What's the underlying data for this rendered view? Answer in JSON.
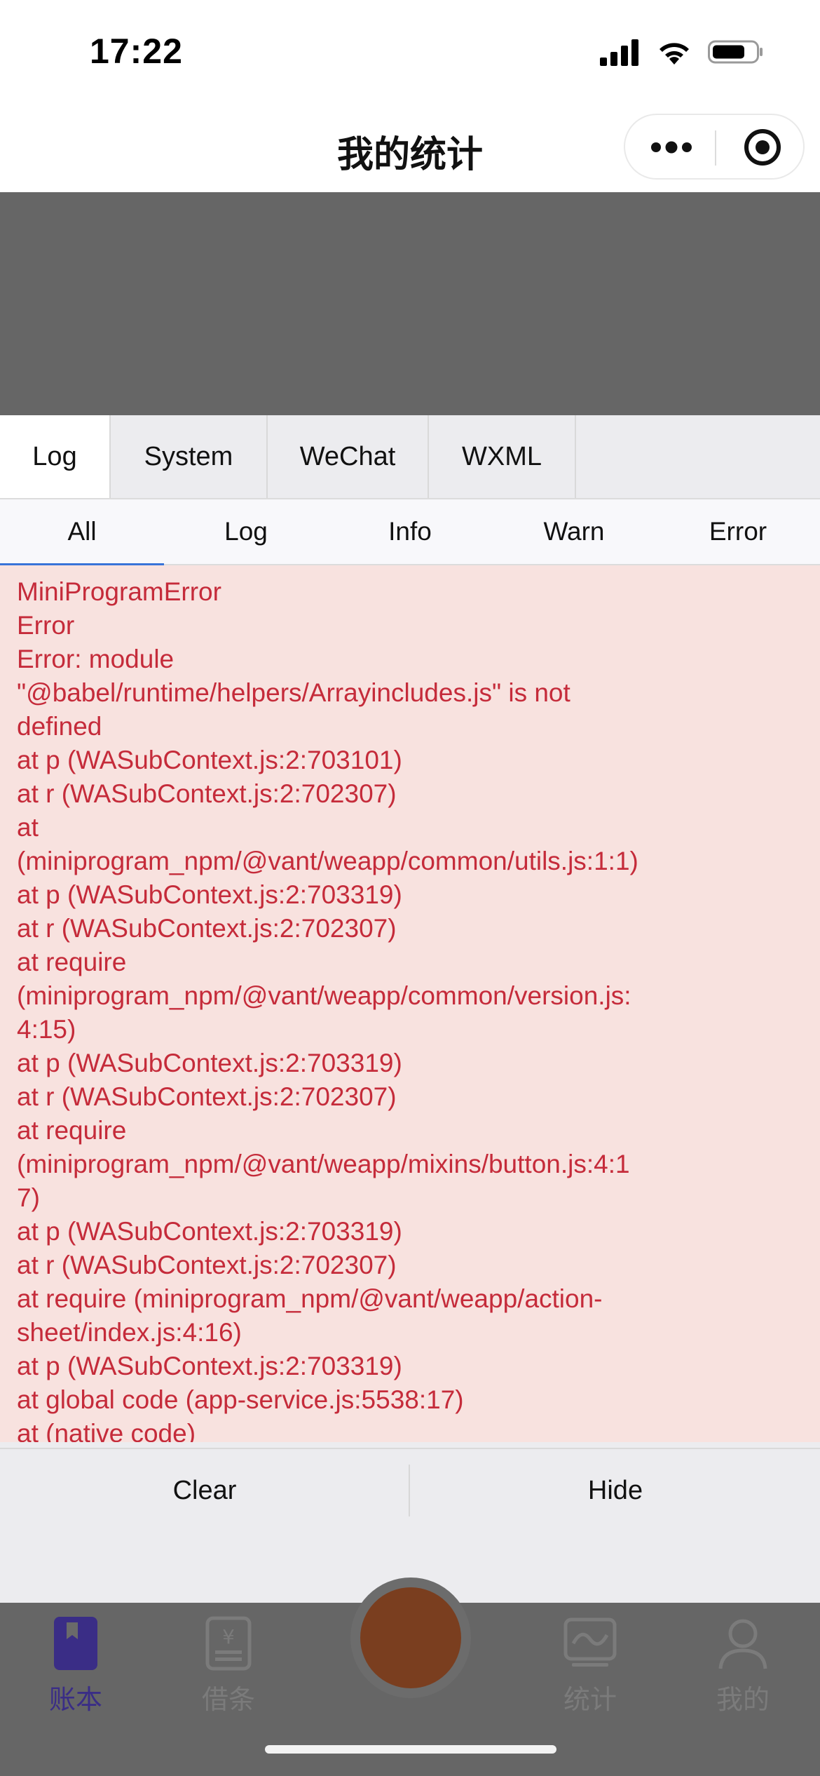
{
  "status_bar": {
    "time": "17:22",
    "icons": [
      "signal-icon",
      "wifi-icon",
      "battery-icon"
    ]
  },
  "nav": {
    "title": "我的统计",
    "capsule": [
      "more-icon",
      "target-icon"
    ]
  },
  "console": {
    "tabs": [
      "Log",
      "System",
      "WeChat",
      "WXML"
    ],
    "active_tab": "Log",
    "subtabs": [
      "All",
      "Log",
      "Info",
      "Warn",
      "Error"
    ],
    "active_subtab": "All",
    "log_lines": [
      "MiniProgramError",
      "Error",
      "Error: module",
      "\"@babel/runtime/helpers/Arrayincludes.js\" is not",
      "defined",
      "at p (WASubContext.js:2:703101)",
      "at r (WASubContext.js:2:702307)",
      "at",
      "(miniprogram_npm/@vant/weapp/common/utils.js:1:1)",
      "at p (WASubContext.js:2:703319)",
      "at r (WASubContext.js:2:702307)",
      "at require",
      "(miniprogram_npm/@vant/weapp/common/version.js:",
      "4:15)",
      "at p (WASubContext.js:2:703319)",
      "at r (WASubContext.js:2:702307)",
      "at require",
      "(miniprogram_npm/@vant/weapp/mixins/button.js:4:1",
      "7)",
      "at p (WASubContext.js:2:703319)",
      "at r (WASubContext.js:2:702307)",
      "at require (miniprogram_npm/@vant/weapp/action-",
      "sheet/index.js:4:16)",
      "at p (WASubContext.js:2:703319)",
      "at global code (app-service.js:5538:17)",
      "at (native code)"
    ],
    "buttons": {
      "clear": "Clear",
      "hide": "Hide"
    },
    "colors": {
      "error_text": "#c52b3a",
      "error_bg": "#f8e2df",
      "active_underline": "#3874d8"
    }
  },
  "tabbar": {
    "items": [
      {
        "label": "账本",
        "icon": "ledger-icon",
        "active": true
      },
      {
        "label": "借条",
        "icon": "iou-icon",
        "active": false
      },
      {
        "label": "统计",
        "icon": "stats-icon",
        "active": false
      },
      {
        "label": "我的",
        "icon": "profile-icon",
        "active": false
      }
    ],
    "center_icon": "add-record-icon",
    "active_color": "#3a2d86"
  }
}
